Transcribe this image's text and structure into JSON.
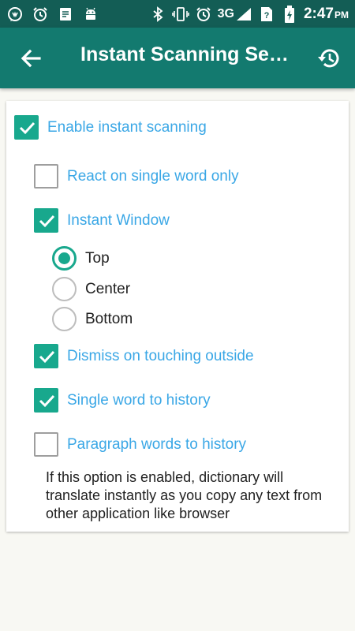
{
  "status_bar": {
    "network": "3G",
    "time": "2:47",
    "ampm": "PM",
    "icons": [
      "whatsapp-icon",
      "alarm-icon",
      "notes-icon",
      "android-icon",
      "bluetooth-icon",
      "vibrate-icon",
      "alarm-icon",
      "signal-icon",
      "no-sim-icon",
      "battery-charging-icon"
    ]
  },
  "app_bar": {
    "title": "Instant Scanning Se…",
    "back_icon": "arrow-back-icon",
    "history_icon": "history-icon"
  },
  "options": {
    "enable_instant_scanning": {
      "label": "Enable instant scanning",
      "checked": true
    },
    "react_single_word": {
      "label": "React on single word only",
      "checked": false
    },
    "instant_window": {
      "label": "Instant Window",
      "checked": true
    },
    "dismiss_outside": {
      "label": "Dismiss on touching outside",
      "checked": true
    },
    "single_word_history": {
      "label": "Single word to history",
      "checked": true
    },
    "paragraph_words_history": {
      "label": "Paragraph words to history",
      "checked": false
    }
  },
  "window_position": {
    "selected": "Top",
    "items": [
      {
        "label": "Top"
      },
      {
        "label": "Center"
      },
      {
        "label": "Bottom"
      }
    ]
  },
  "description": "If this option is enabled, dictionary will translate instantly as you copy any text from other application like browser",
  "colors": {
    "status_bar": "#135d55",
    "app_bar": "#137a6f",
    "accent": "#18a88d",
    "label_blue": "#3aa7e6"
  }
}
